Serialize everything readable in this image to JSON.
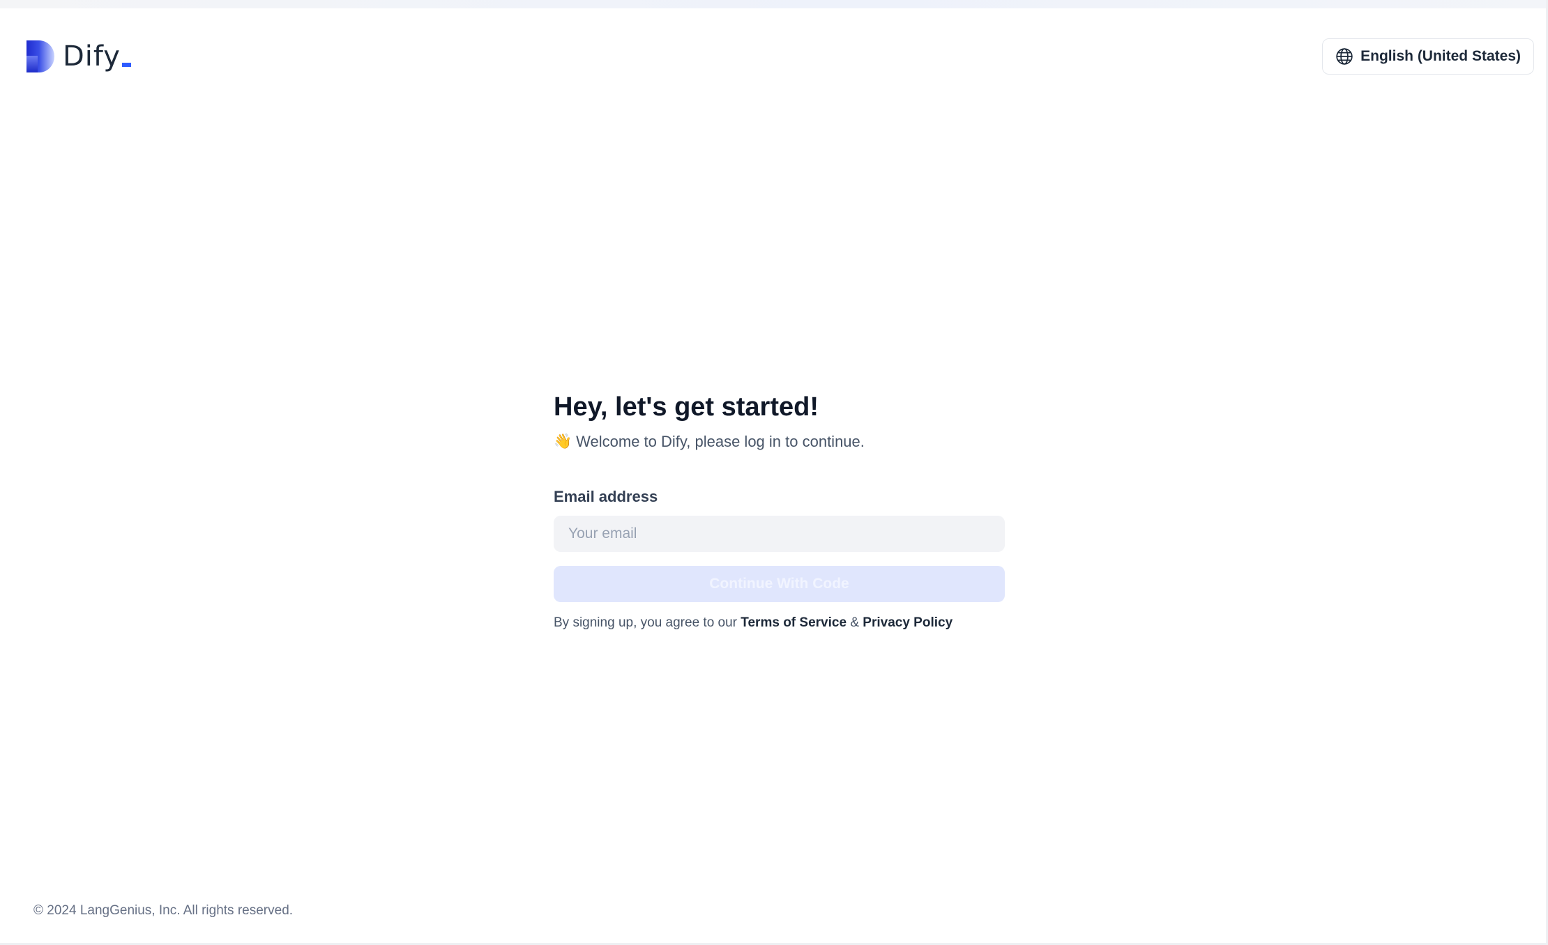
{
  "brand": {
    "name": "Dify",
    "accent_color": "#2e5bff"
  },
  "header": {
    "language_label": "English (United States)",
    "language_icon": "globe-icon"
  },
  "login": {
    "title": "Hey, let's get started!",
    "subtitle_emoji": "👋",
    "subtitle": "Welcome to Dify, please log in to continue.",
    "email_label": "Email address",
    "email_placeholder": "Your email",
    "email_value": "",
    "continue_label": "Continue With Code",
    "terms_prefix": "By signing up, you agree to our",
    "terms_link": "Terms of Service",
    "terms_joiner": "&",
    "privacy_link": "Privacy Policy"
  },
  "footer": {
    "copyright": "© 2024 LangGenius, Inc. All rights reserved."
  }
}
